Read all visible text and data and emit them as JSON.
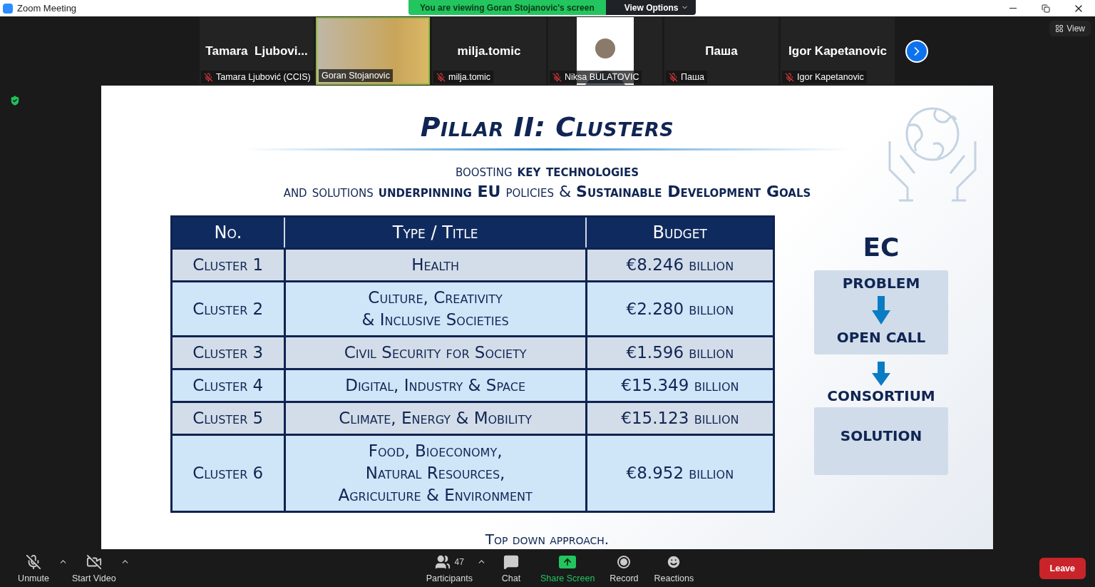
{
  "window": {
    "title": "Zoom Meeting"
  },
  "share_banner": {
    "text": "You are viewing Goran Stojanovic's screen",
    "options": "View Options"
  },
  "view_button": "View",
  "participants": [
    {
      "kind": "name",
      "display": "Tamara  Ljubovi...",
      "name": "Tamara Ljubović (CCIS)",
      "muted": true,
      "speaking": false
    },
    {
      "kind": "video",
      "name": "Goran Stojanovic",
      "muted": false,
      "speaking": true
    },
    {
      "kind": "name",
      "display": "milja.tomic",
      "name": "milja.tomic",
      "muted": true,
      "speaking": false
    },
    {
      "kind": "photo",
      "name": "Niksa BULATOVIC",
      "muted": true,
      "speaking": false
    },
    {
      "kind": "name",
      "display": "Паша",
      "name": "Паша",
      "muted": true,
      "speaking": false
    },
    {
      "kind": "name",
      "display": "Igor Kapetanovic",
      "name": "Igor Kapetanovic",
      "muted": true,
      "speaking": false
    }
  ],
  "slide": {
    "title": "Pillar II: Clusters",
    "subtitle": [
      "boosting **key technologies**",
      "and solutions **underpinning EU** policies & **Sustainable Development Goals**"
    ],
    "table": {
      "columns": [
        "No.",
        "Type / Title",
        "Budget"
      ],
      "rows": [
        [
          "Cluster 1",
          "Health",
          "€8.246 billion"
        ],
        [
          "Cluster 2",
          "Culture, Creativity\n& Inclusive Societies",
          "€2.280 billion"
        ],
        [
          "Cluster 3",
          "Civil Security for Society",
          "€1.596 billion"
        ],
        [
          "Cluster 4",
          "Digital, Industry & Space",
          "€15.349 billion"
        ],
        [
          "Cluster 5",
          "Climate, Energy & Mobility",
          "€15.123 billion"
        ],
        [
          "Cluster 6",
          "Food, Bioeconomy,\nNatural Resources,\nAgriculture & Environment",
          "€8.952 billion"
        ]
      ]
    },
    "flow": {
      "heading": "EC",
      "steps": [
        "PROBLEM",
        "OPEN CALL"
      ],
      "between": "CONSORTIUM",
      "result": "SOLUTION"
    },
    "footer": "Top down approach."
  },
  "toolbar": {
    "items": [
      {
        "kind": "mic",
        "label": "Unmute",
        "off": true,
        "caret": true
      },
      {
        "kind": "video",
        "label": "Start Video",
        "off": true,
        "caret": true
      },
      {
        "kind": "participants",
        "label": "Participants",
        "count": "47",
        "caret": true
      },
      {
        "kind": "chat",
        "label": "Chat"
      },
      {
        "kind": "share",
        "label": "Share Screen"
      },
      {
        "kind": "record",
        "label": "Record"
      },
      {
        "kind": "reactions",
        "label": "Reactions"
      }
    ],
    "leave": "Leave"
  }
}
